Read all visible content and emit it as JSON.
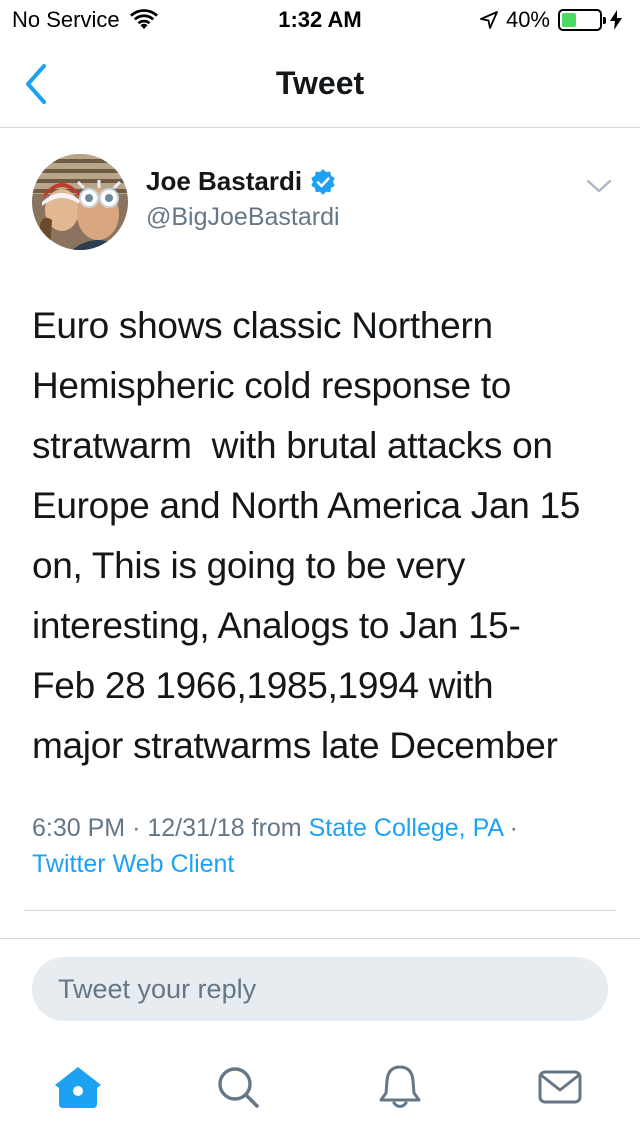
{
  "status_bar": {
    "carrier": "No Service",
    "time": "1:32 AM",
    "battery_percent": "40%",
    "battery_level": 0.4,
    "icons": [
      "wifi-icon",
      "location-arrow-icon",
      "battery-icon",
      "charging-bolt-icon"
    ]
  },
  "nav": {
    "title": "Tweet",
    "back_icon": "chevron-left-icon"
  },
  "tweet": {
    "display_name": "Joe Bastardi",
    "verified": true,
    "handle": "@BigJoeBastardi",
    "text": "Euro shows classic Northern\nHemispheric cold response to\nstratwarm  with brutal attacks on\nEurope and North America Jan 15\non, This is going to be very\ninteresting, Analogs to Jan 15-\nFeb 28 1966,1985,1994 with\nmajor stratwarms late December",
    "time": "6:30 PM",
    "date": "12/31/18",
    "from_label": "from",
    "location": "State College, PA",
    "separator": "·",
    "client": "Twitter Web Client"
  },
  "reply": {
    "placeholder": "Tweet your reply"
  },
  "tab_bar": {
    "tabs": [
      {
        "name": "home",
        "icon": "home-icon",
        "active": true
      },
      {
        "name": "search",
        "icon": "search-icon",
        "active": false
      },
      {
        "name": "notifications",
        "icon": "bell-icon",
        "active": false
      },
      {
        "name": "messages",
        "icon": "envelope-icon",
        "active": false
      }
    ]
  },
  "colors": {
    "accent": "#1da1f2",
    "text": "#14171a",
    "secondary": "#657786",
    "battery": "#4cd964",
    "reply_bg": "#e6ecf0"
  }
}
